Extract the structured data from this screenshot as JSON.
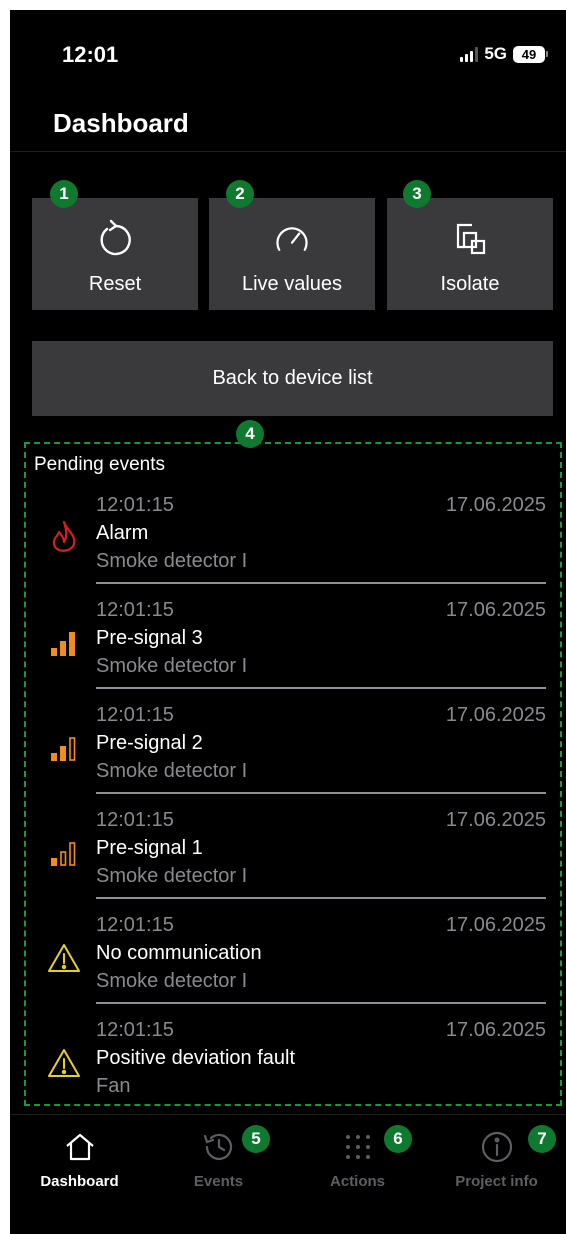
{
  "status_bar": {
    "time": "12:01",
    "network": "5G",
    "battery": "49"
  },
  "header": {
    "title": "Dashboard"
  },
  "actions": [
    {
      "label": "Reset",
      "badge": "1",
      "icon": "reset-icon"
    },
    {
      "label": "Live values",
      "badge": "2",
      "icon": "gauge-icon"
    },
    {
      "label": "Isolate",
      "badge": "3",
      "icon": "isolate-icon"
    }
  ],
  "back_button": {
    "label": "Back to device list"
  },
  "events": {
    "badge": "4",
    "title": "Pending events",
    "items": [
      {
        "time": "12:01:15",
        "date": "17.06.2025",
        "name": "Alarm",
        "source": "Smoke detector I",
        "icon": "fire-icon"
      },
      {
        "time": "12:01:15",
        "date": "17.06.2025",
        "name": "Pre-signal 3",
        "source": "Smoke detector I",
        "icon": "signal-3-icon"
      },
      {
        "time": "12:01:15",
        "date": "17.06.2025",
        "name": "Pre-signal 2",
        "source": "Smoke detector I",
        "icon": "signal-2-icon"
      },
      {
        "time": "12:01:15",
        "date": "17.06.2025",
        "name": "Pre-signal 1",
        "source": "Smoke detector I",
        "icon": "signal-1-icon"
      },
      {
        "time": "12:01:15",
        "date": "17.06.2025",
        "name": "No communication",
        "source": "Smoke detector I",
        "icon": "warning-icon"
      },
      {
        "time": "12:01:15",
        "date": "17.06.2025",
        "name": "Positive deviation fault",
        "source": "Fan",
        "icon": "warning-icon"
      }
    ]
  },
  "tabs": [
    {
      "label": "Dashboard",
      "active": true,
      "icon": "home-icon"
    },
    {
      "label": "Events",
      "badge": "5",
      "icon": "history-icon"
    },
    {
      "label": "Actions",
      "badge": "6",
      "icon": "grid-dots-icon"
    },
    {
      "label": "Project info",
      "badge": "7",
      "icon": "info-icon"
    }
  ],
  "colors": {
    "accent_badge": "#0f7a2f",
    "alarm": "#d81e1e",
    "presignal": "#f28c1e",
    "warning": "#e6d21e",
    "tile": "#3a3a3c"
  }
}
